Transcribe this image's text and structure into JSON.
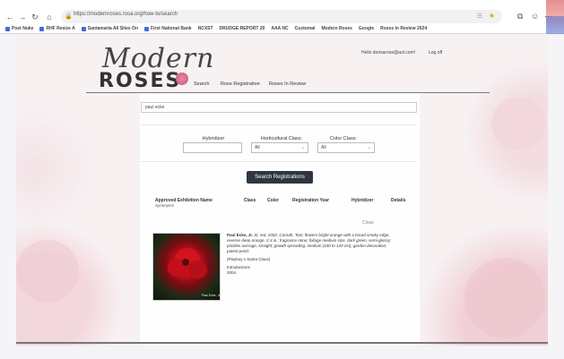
{
  "browser": {
    "url": "https://modernroses.rosa.org/how-to/search",
    "bookmarks": [
      "Post Nuke",
      "RHF Resize A",
      "Santamaria All Sites On",
      "First National Bank",
      "NCXST",
      "DRUDGE REPORT 20",
      "AAA NC",
      "Customal",
      "Modern Roses",
      "Google",
      "Roses In Review 2024"
    ]
  },
  "header": {
    "logo_line1": "Modern",
    "logo_line2": "ROSES",
    "nav": [
      "Search",
      "Rose Registration",
      "Roses In Review"
    ],
    "greeting": "Hello dorisarose@aol.com!",
    "logoff": "Log off"
  },
  "search": {
    "value": "paul ecke"
  },
  "filters": {
    "hybridizer_label": "Hybridizer",
    "hybridizer_value": "",
    "horticultural_label": "Horticultural Class:",
    "horticultural_value": "All",
    "color_label": "Color Class:",
    "color_value": "All"
  },
  "search_button": "Search Registrations",
  "table": {
    "headers": [
      "Approved Exhibition Name",
      "Class",
      "Color",
      "Registration Year",
      "Hybridizer",
      "Details"
    ],
    "synonym": "Synonyms"
  },
  "detail": {
    "close": "Close",
    "name": "Paul Ecke, Jr.",
    "description": "Sl, red, 2002; Carruth, Tom; flowers bright orange with a broad smoky edge, reverse deep orange, 2-3 in.; fragrance none; foliage medium size, dark green, semi-glossy; prickles average, straight; growth spreading, medium (100 to 120 cm); garden decoration; patent pend.",
    "parentage": "(Playboy x Santa Claus)",
    "introductions_label": "Introductions",
    "introductions_year": "2004",
    "photo_caption": "Paul Ecke, Jr."
  }
}
